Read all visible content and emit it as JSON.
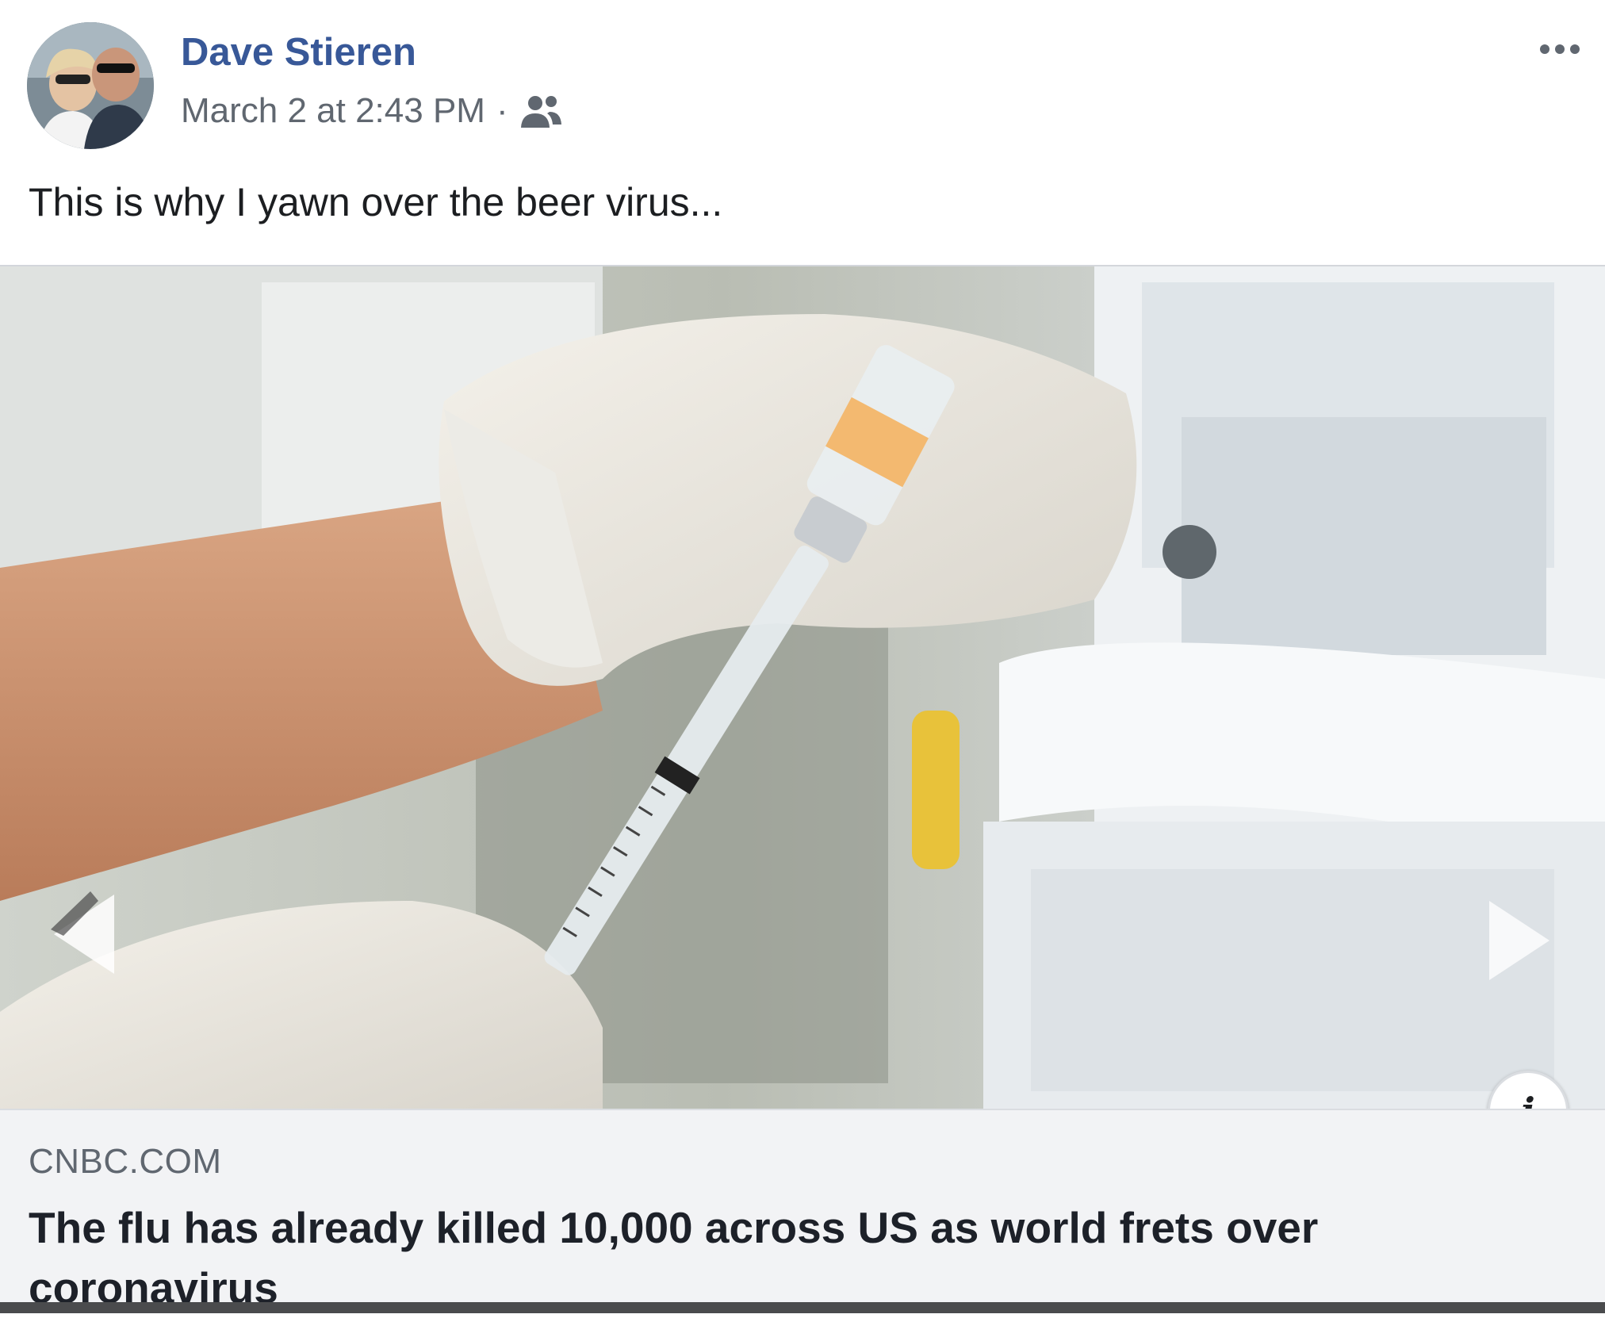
{
  "post": {
    "author_name": "Dave Stieren",
    "timestamp": "March 2 at 2:43 PM",
    "meta_separator": "·",
    "audience_icon": "friends-icon",
    "more_icon": "ellipsis-icon",
    "text": "This is why I yawn over the beer virus..."
  },
  "media": {
    "prev_icon": "chevron-left-icon",
    "next_icon": "chevron-right-icon",
    "info_label": "i"
  },
  "link_preview": {
    "domain": "CNBC.COM",
    "title": "The flu has already killed 10,000 across US as world frets over coronavirus"
  },
  "colors": {
    "author_link": "#385898",
    "meta_text": "#606770",
    "body_text": "#1c1e21",
    "preview_bg": "#f2f3f5"
  }
}
